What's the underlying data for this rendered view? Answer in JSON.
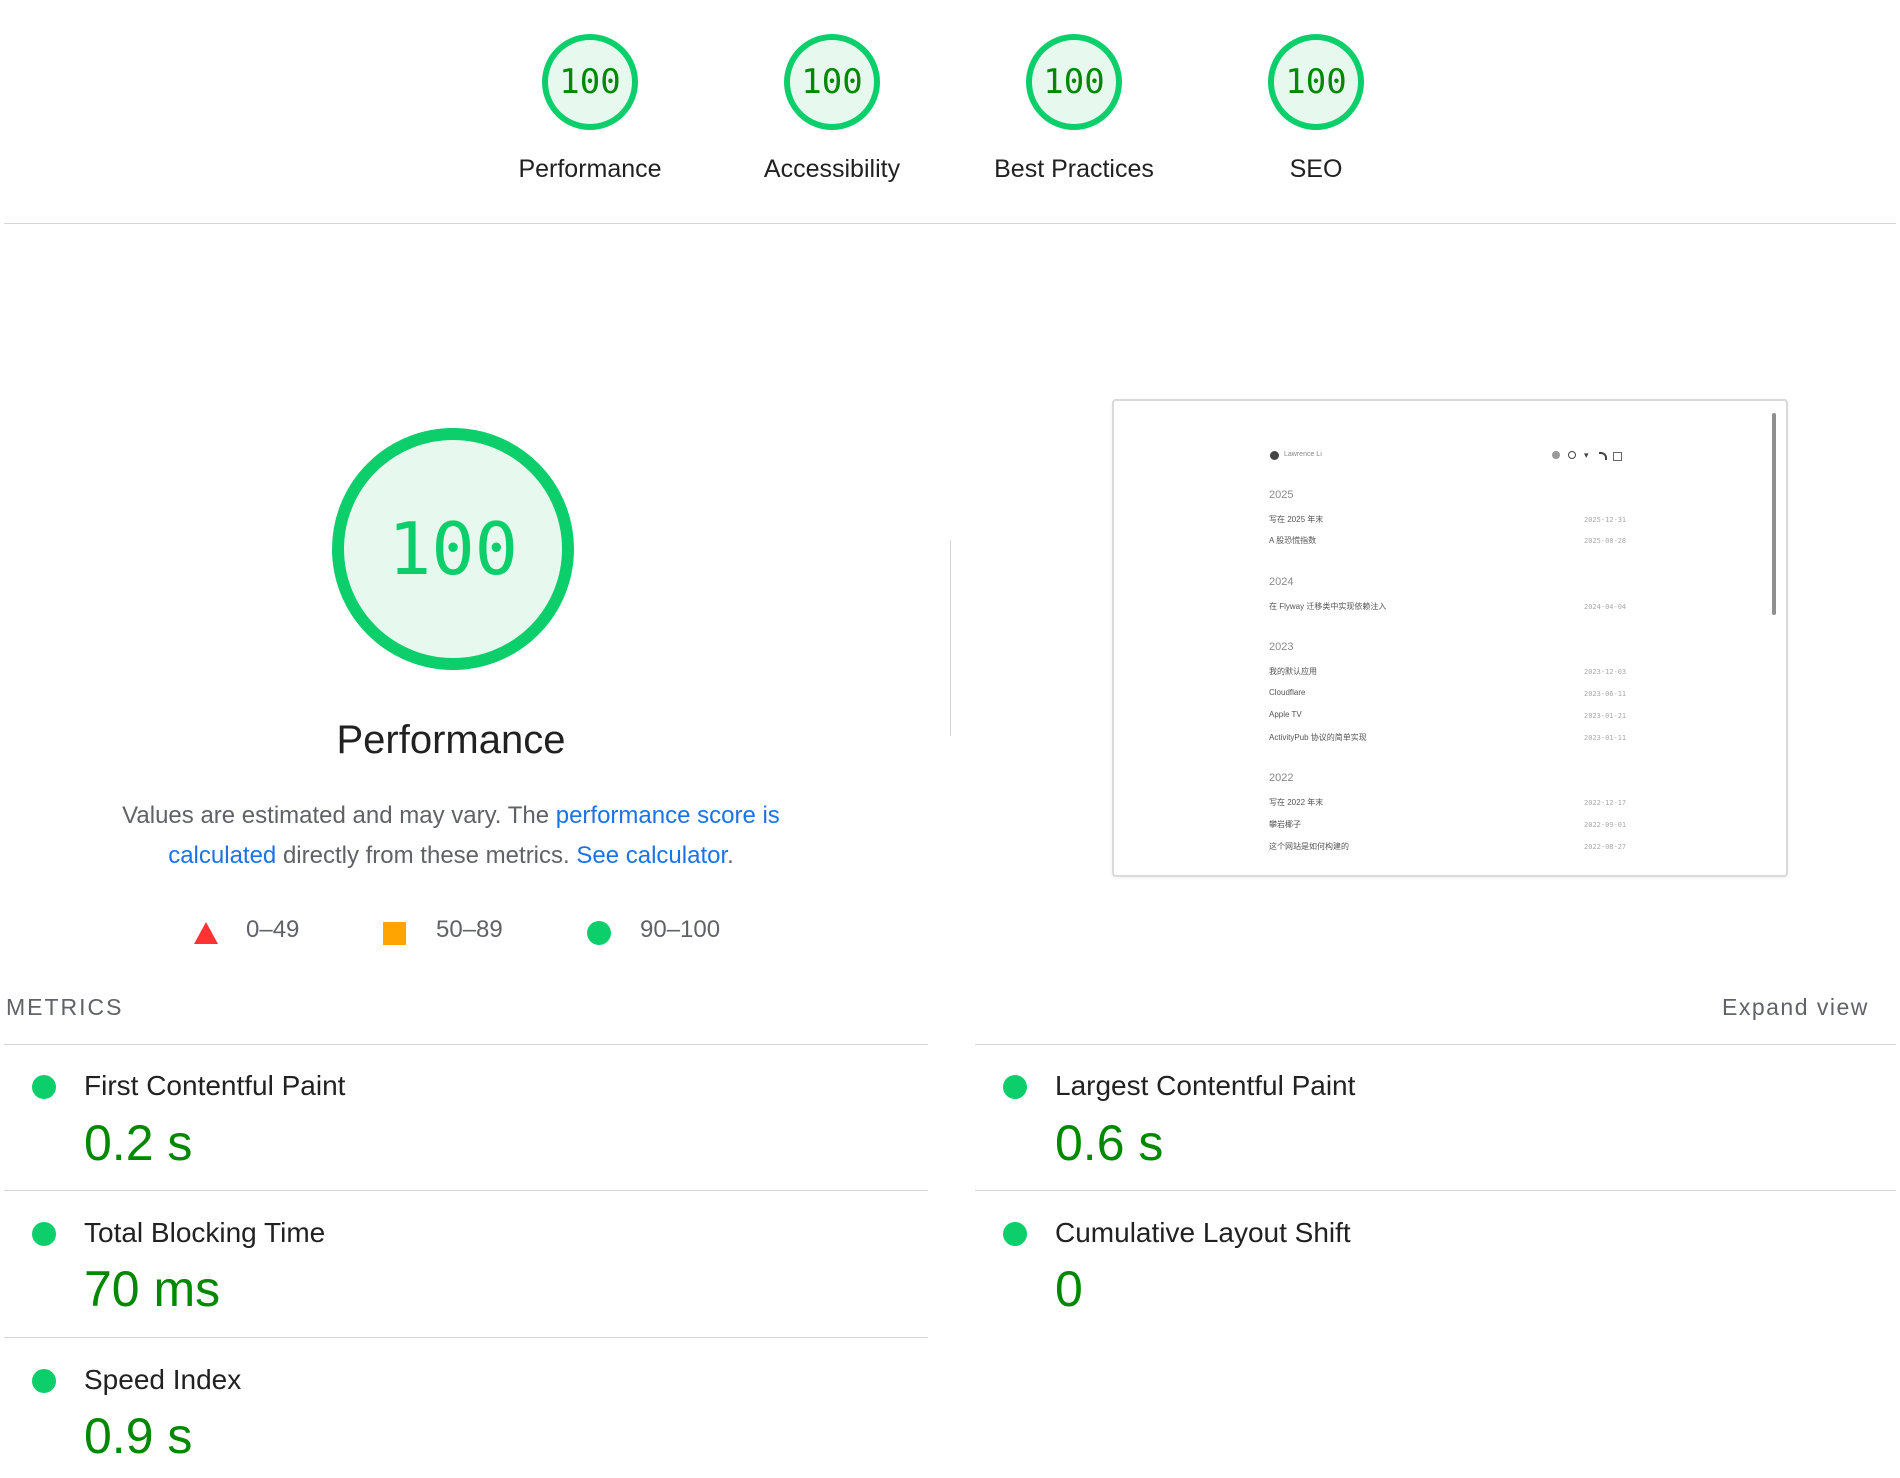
{
  "top_scores": [
    {
      "score": "100",
      "label": "Performance"
    },
    {
      "score": "100",
      "label": "Accessibility"
    },
    {
      "score": "100",
      "label": "Best Practices"
    },
    {
      "score": "100",
      "label": "SEO"
    }
  ],
  "performance": {
    "score": "100",
    "title": "Performance",
    "description": {
      "part1": "Values are estimated and may vary. The ",
      "link1": "performance score is calculated",
      "part2": " directly from these metrics. ",
      "link2": "See calculator",
      "part3": "."
    }
  },
  "legend": [
    {
      "range": "0–49",
      "shape": "triangle",
      "color": "#f33"
    },
    {
      "range": "50–89",
      "shape": "square",
      "color": "#ffa400"
    },
    {
      "range": "90–100",
      "shape": "circle",
      "color": "#0cce6b"
    }
  ],
  "screenshot": {
    "site_name": "Lawrence Li",
    "groups": [
      {
        "year": "2025",
        "posts": [
          {
            "title": "写在 2025 年末",
            "date": "2025-12-31"
          },
          {
            "title": "A 股恐慌指数",
            "date": "2025-08-28"
          }
        ]
      },
      {
        "year": "2024",
        "posts": [
          {
            "title": "在 Flyway 迁移类中实现依赖注入",
            "date": "2024-04-04"
          }
        ]
      },
      {
        "year": "2023",
        "posts": [
          {
            "title": "我的默认应用",
            "date": "2023-12-03"
          },
          {
            "title": "Cloudflare",
            "date": "2023-06-11"
          },
          {
            "title": "Apple TV",
            "date": "2023-01-21"
          },
          {
            "title": "ActivityPub 协议的简单实现",
            "date": "2023-01-11"
          }
        ]
      },
      {
        "year": "2022",
        "posts": [
          {
            "title": "写在 2022 年末",
            "date": "2022-12-17"
          },
          {
            "title": "攀岩椰子",
            "date": "2022-09-01"
          },
          {
            "title": "这个网站是如何构建的",
            "date": "2022-08-27"
          }
        ]
      }
    ]
  },
  "metrics": {
    "heading": "METRICS",
    "expand_label": "Expand view",
    "items": [
      {
        "label": "First Contentful Paint",
        "value": "0.2 s"
      },
      {
        "label": "Largest Contentful Paint",
        "value": "0.6 s"
      },
      {
        "label": "Total Blocking Time",
        "value": "70 ms"
      },
      {
        "label": "Cumulative Layout Shift",
        "value": "0"
      },
      {
        "label": "Speed Index",
        "value": "0.9 s"
      }
    ]
  },
  "colors": {
    "pass": "#0cce6b",
    "pass_text": "#008800",
    "link": "#1a73e8"
  }
}
